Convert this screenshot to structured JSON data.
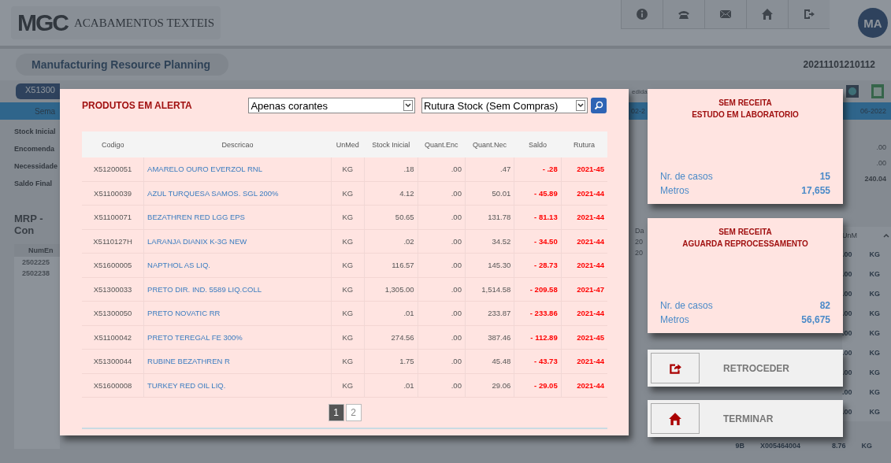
{
  "header": {
    "logo": "MGC",
    "company": "ACABAMENTOS TEXTEIS",
    "avatar": "MA"
  },
  "page": {
    "title": "Manufacturing Resource Planning",
    "timestamp": "20211101210112",
    "article": "X51300",
    "week_label": "Sema",
    "summary_labels": [
      "Stock Inicial",
      "Encomenda",
      "Necessidade",
      "Saldo Final"
    ],
    "section_title": "MRP - Con",
    "orders_header": "NumEn",
    "orders": [
      "2502225",
      "2502238"
    ]
  },
  "background_right": {
    "header": "edida",
    "date_from": "02-2",
    "date_to": "06-2022",
    "values": [
      ".00",
      ".00",
      "240.04"
    ],
    "date_header": "Da",
    "dates": [
      "20",
      "20"
    ],
    "unit_header": "UnM",
    "rows": [
      {
        "qty": ".00",
        "unit": "KG"
      },
      {
        "qty": ".00",
        "unit": "KG"
      },
      {
        "qty": ".00",
        "unit": "KG"
      },
      {
        "qty": ".00",
        "unit": "KG"
      },
      {
        "qty": ".00",
        "unit": "KG"
      },
      {
        "qty": ".00",
        "unit": "KG"
      },
      {
        "qty": ".00",
        "unit": "KG"
      },
      {
        "qty": ".00",
        "unit": "KG"
      },
      {
        "qty": ".00",
        "unit": "KG"
      }
    ],
    "last_row": {
      "week": "9B",
      "code": "X005464004",
      "qty": "8.76",
      "unit": "KG"
    }
  },
  "modal": {
    "title": "PRODUTOS EM ALERTA",
    "filter_1": "Apenas corantes",
    "filter_2": "Rutura Stock (Sem Compras)",
    "columns": [
      "Codigo",
      "Descricao",
      "UnMed",
      "Stock Inicial",
      "Quant.Enc",
      "Quant.Nec",
      "Saldo",
      "Rutura"
    ],
    "rows": [
      [
        "X51200051",
        "AMARELO OURO EVERZOL RNL",
        "KG",
        ".18",
        ".00",
        ".47",
        "- .28",
        "2021-45"
      ],
      [
        "X51100039",
        "AZUL TURQUESA SAMOS. SGL 200%",
        "KG",
        "4.12",
        ".00",
        "50.01",
        "- 45.89",
        "2021-44"
      ],
      [
        "X51100071",
        "BEZATHREN RED LGG EPS",
        "KG",
        "50.65",
        ".00",
        "131.78",
        "- 81.13",
        "2021-44"
      ],
      [
        "X5110127H",
        "LARANJA DIANIX K-3G NEW",
        "KG",
        ".02",
        ".00",
        "34.52",
        "- 34.50",
        "2021-44"
      ],
      [
        "X51600005",
        "NAPTHOL AS LIQ.",
        "KG",
        "116.57",
        ".00",
        "145.30",
        "- 28.73",
        "2021-44"
      ],
      [
        "X51300033",
        "PRETO DIR. IND. 5589 LIQ.COLL",
        "KG",
        "1,305.00",
        ".00",
        "1,514.58",
        "- 209.58",
        "2021-47"
      ],
      [
        "X51300050",
        "PRETO NOVATIC RR",
        "KG",
        ".01",
        ".00",
        "233.87",
        "- 233.86",
        "2021-44"
      ],
      [
        "X51100042",
        "PRETO TEREGAL FE 300%",
        "KG",
        "274.56",
        ".00",
        "387.46",
        "- 112.89",
        "2021-45"
      ],
      [
        "X51300044",
        "RUBINE BEZATHREN R",
        "KG",
        "1.75",
        ".00",
        "45.48",
        "- 43.73",
        "2021-44"
      ],
      [
        "X51600008",
        "TURKEY RED OIL LIQ.",
        "KG",
        ".01",
        ".00",
        "29.06",
        "- 29.05",
        "2021-44"
      ]
    ],
    "pages": [
      {
        "label": "1",
        "selected": true
      },
      {
        "label": "2",
        "selected": false
      }
    ]
  },
  "cards": [
    {
      "title": "SEM RECEITA",
      "subtitle": "ESTUDO EM LABORATORIO",
      "cases_label": "Nr. de casos",
      "cases": "15",
      "meters_label": "Metros",
      "meters": "17,655"
    },
    {
      "title": "SEM RECEITA",
      "subtitle": "AGUARDA REPROCESSAMENTO",
      "cases_label": "Nr. de casos",
      "cases": "82",
      "meters_label": "Metros",
      "meters": "56,675"
    }
  ],
  "actions": [
    {
      "kind": "back",
      "label": "RETROCEDER"
    },
    {
      "kind": "home",
      "label": "TERMINAR"
    }
  ]
}
